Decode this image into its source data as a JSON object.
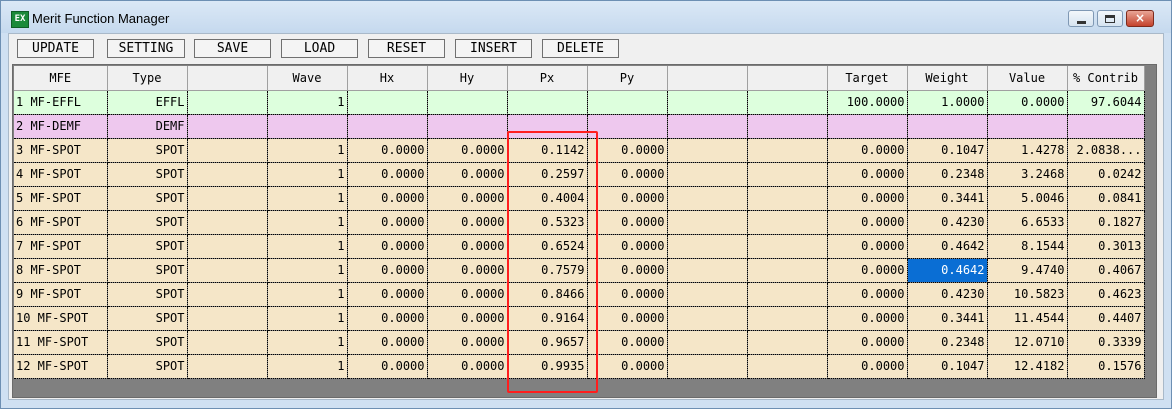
{
  "window": {
    "title": "Merit Function Manager",
    "icon_text": "EX",
    "icon": "app-icon",
    "close_glyph": "×"
  },
  "toolbar": {
    "buttons": [
      "UPDATE",
      "SETTING",
      "SAVE",
      "LOAD",
      "RESET",
      "INSERT",
      "DELETE"
    ]
  },
  "table": {
    "headers": [
      "MFE",
      "Type",
      "",
      "Wave",
      "Hx",
      "Hy",
      "Px",
      "Py",
      "",
      "",
      "Target",
      "Weight",
      "Value",
      "% Contrib"
    ],
    "rows": [
      {
        "kind": "effl",
        "cells": [
          "1 MF-EFFL",
          "EFFL",
          "",
          "1",
          "",
          "",
          "",
          "",
          "",
          "",
          "100.0000",
          "1.0000",
          "0.0000",
          "97.6044"
        ]
      },
      {
        "kind": "demf",
        "cells": [
          "2 MF-DEMF",
          "DEMF",
          "",
          "",
          "",
          "",
          "",
          "",
          "",
          "",
          "",
          "",
          "",
          ""
        ]
      },
      {
        "kind": "spot",
        "cells": [
          "3 MF-SPOT",
          "SPOT",
          "",
          "1",
          "0.0000",
          "0.0000",
          "0.1142",
          "0.0000",
          "",
          "",
          "0.0000",
          "0.1047",
          "1.4278",
          "2.0838..."
        ]
      },
      {
        "kind": "spot",
        "cells": [
          "4 MF-SPOT",
          "SPOT",
          "",
          "1",
          "0.0000",
          "0.0000",
          "0.2597",
          "0.0000",
          "",
          "",
          "0.0000",
          "0.2348",
          "3.2468",
          "0.0242"
        ]
      },
      {
        "kind": "spot",
        "cells": [
          "5 MF-SPOT",
          "SPOT",
          "",
          "1",
          "0.0000",
          "0.0000",
          "0.4004",
          "0.0000",
          "",
          "",
          "0.0000",
          "0.3441",
          "5.0046",
          "0.0841"
        ]
      },
      {
        "kind": "spot",
        "cells": [
          "6 MF-SPOT",
          "SPOT",
          "",
          "1",
          "0.0000",
          "0.0000",
          "0.5323",
          "0.0000",
          "",
          "",
          "0.0000",
          "0.4230",
          "6.6533",
          "0.1827"
        ]
      },
      {
        "kind": "spot",
        "cells": [
          "7 MF-SPOT",
          "SPOT",
          "",
          "1",
          "0.0000",
          "0.0000",
          "0.6524",
          "0.0000",
          "",
          "",
          "0.0000",
          "0.4642",
          "8.1544",
          "0.3013"
        ]
      },
      {
        "kind": "spot",
        "cells": [
          "8 MF-SPOT",
          "SPOT",
          "",
          "1",
          "0.0000",
          "0.0000",
          "0.7579",
          "0.0000",
          "",
          "",
          "0.0000",
          "0.4642",
          "9.4740",
          "0.4067"
        ]
      },
      {
        "kind": "spot",
        "cells": [
          "9 MF-SPOT",
          "SPOT",
          "",
          "1",
          "0.0000",
          "0.0000",
          "0.8466",
          "0.0000",
          "",
          "",
          "0.0000",
          "0.4230",
          "10.5823",
          "0.4623"
        ]
      },
      {
        "kind": "spot",
        "cells": [
          "10 MF-SPOT",
          "SPOT",
          "",
          "1",
          "0.0000",
          "0.0000",
          "0.9164",
          "0.0000",
          "",
          "",
          "0.0000",
          "0.3441",
          "11.4544",
          "0.4407"
        ]
      },
      {
        "kind": "spot",
        "cells": [
          "11 MF-SPOT",
          "SPOT",
          "",
          "1",
          "0.0000",
          "0.0000",
          "0.9657",
          "0.0000",
          "",
          "",
          "0.0000",
          "0.2348",
          "12.0710",
          "0.3339"
        ]
      },
      {
        "kind": "spot",
        "cells": [
          "12 MF-SPOT",
          "SPOT",
          "",
          "1",
          "0.0000",
          "0.0000",
          "0.9935",
          "0.0000",
          "",
          "",
          "0.0000",
          "0.1047",
          "12.4182",
          "0.1576"
        ]
      }
    ],
    "selected_cell": {
      "row": 7,
      "column": "Weight"
    }
  },
  "colors": {
    "effl_row": "#ddffdd",
    "demf_row": "#eec8ee",
    "spot_row": "#f5e6c8",
    "selection": "#0a6ed4",
    "highlight_box": "#ff1e1e"
  }
}
